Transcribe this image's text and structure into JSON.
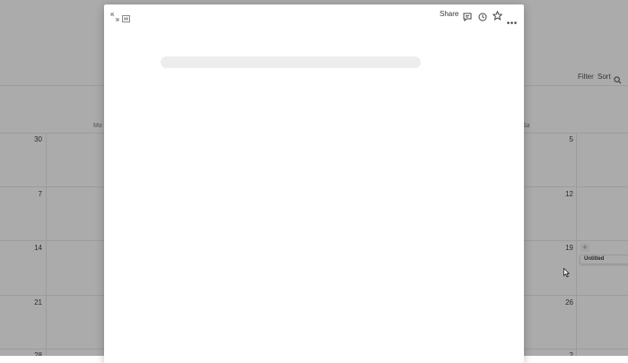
{
  "toolbar": {
    "filter_label": "Filter",
    "sort_label": "Sort",
    "search_icon": "search-icon"
  },
  "calendar": {
    "weekday_labels": [
      "Mo",
      "Sa"
    ],
    "left_day_numbers": [
      "30",
      "7",
      "14",
      "21",
      "28"
    ],
    "right_day_numbers": [
      "5",
      "12",
      "19",
      "26",
      "2"
    ],
    "card_title": "Untitled",
    "add_icon": "plus-icon"
  },
  "modal": {
    "share_label": "Share",
    "icons": [
      "expand-icon",
      "open-as-page-icon",
      "comment-icon",
      "history-icon",
      "star-icon",
      "more-icon"
    ]
  }
}
